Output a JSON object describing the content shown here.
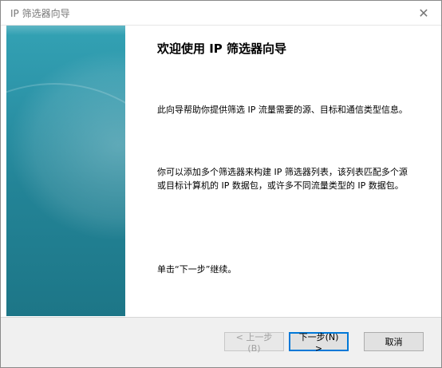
{
  "window": {
    "title": "IP 筛选器向导",
    "close_glyph": "✕"
  },
  "content": {
    "heading": "欢迎使用 IP 筛选器向导",
    "paragraph_1": "此向导帮助你提供筛选 IP 流量需要的源、目标和通信类型信息。",
    "paragraph_2": "你可以添加多个筛选器来构建 IP 筛选器列表，该列表匹配多个源或目标计算机的 IP 数据包，或许多不同流量类型的 IP 数据包。",
    "paragraph_3": "单击“下一步”继续。"
  },
  "buttons": {
    "back": "< 上一步(B)",
    "next": "下一步(N) >",
    "cancel": "取消"
  },
  "colors": {
    "sidebar_top": "#33a2b4",
    "sidebar_bottom": "#1d7687",
    "default_button_border": "#0078d7"
  }
}
